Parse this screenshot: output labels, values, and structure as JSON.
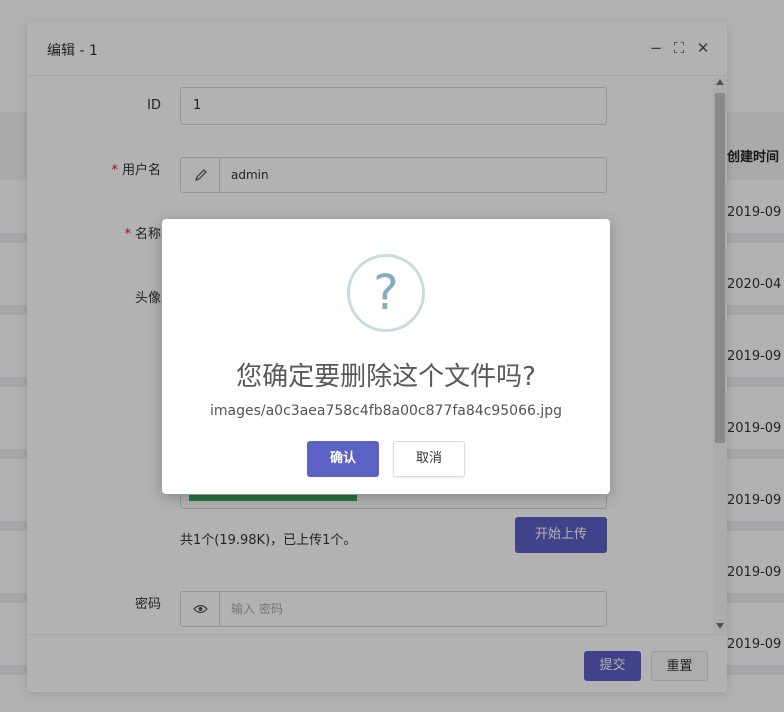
{
  "background_table": {
    "header_label": "创建时间",
    "rows": [
      "2019-09",
      "2020-04",
      "2019-09",
      "2019-09",
      "2019-09",
      "2019-09",
      "2019-09"
    ]
  },
  "edit_window": {
    "title": "编辑 - 1",
    "controls": {
      "minimize": "−",
      "maximize": "⛶",
      "close": "✕"
    },
    "fields": {
      "id_label": "ID",
      "id_value": "1",
      "username_label": "用户名",
      "username_value": "admin",
      "name_label": "名称",
      "avatar_label": "头像",
      "password_label": "密码",
      "password_placeholder": "输入 密码"
    },
    "upload": {
      "info": "共1个(19.98K)，已上传1个。",
      "start_button": "开始上传",
      "progress": 0.41
    },
    "footer": {
      "submit": "提交",
      "reset": "重置"
    }
  },
  "confirm_dialog": {
    "icon": "?",
    "title": "您确定要删除这个文件吗?",
    "text": "images/a0c3aea758c4fb8a00c877fa84c95066.jpg",
    "ok": "确认",
    "cancel": "取消"
  },
  "colors": {
    "primary": "#5c61c4",
    "required": "#e02020",
    "progress": "#3aa85a",
    "question_icon": "#87adbd"
  }
}
